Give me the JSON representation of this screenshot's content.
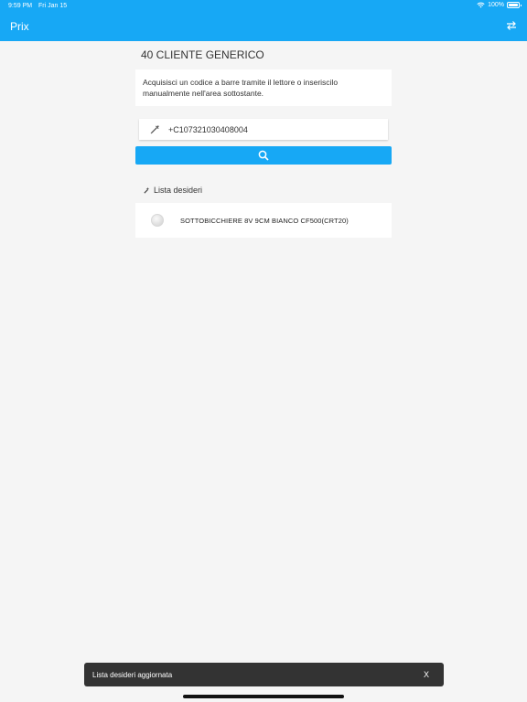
{
  "status_bar": {
    "time": "9:59 PM",
    "date": "Fri Jan 15",
    "battery": "100%"
  },
  "header": {
    "title": "Prix",
    "swap_icon": "swap-arrows-icon",
    "background_color": "#17a8f5"
  },
  "customer": {
    "title": "40 CLIENTE GENERICO"
  },
  "info": {
    "text": "Acquisisci un codice a barre tramite il lettore o inseriscilo manualmente nell'area sottostante."
  },
  "code_input": {
    "value": "+C107321030408004",
    "icon": "barcode-scan-icon"
  },
  "search_button": {
    "icon": "search-icon"
  },
  "wishlist": {
    "title": "Lista desideri",
    "icon": "magic-wand-icon",
    "items": [
      {
        "name": "SOTTOBICCHIERE 8V 9CM BIANCO CF500(CRT20)"
      }
    ]
  },
  "toast": {
    "message": "Lista desideri aggiornata",
    "close_label": "X"
  }
}
